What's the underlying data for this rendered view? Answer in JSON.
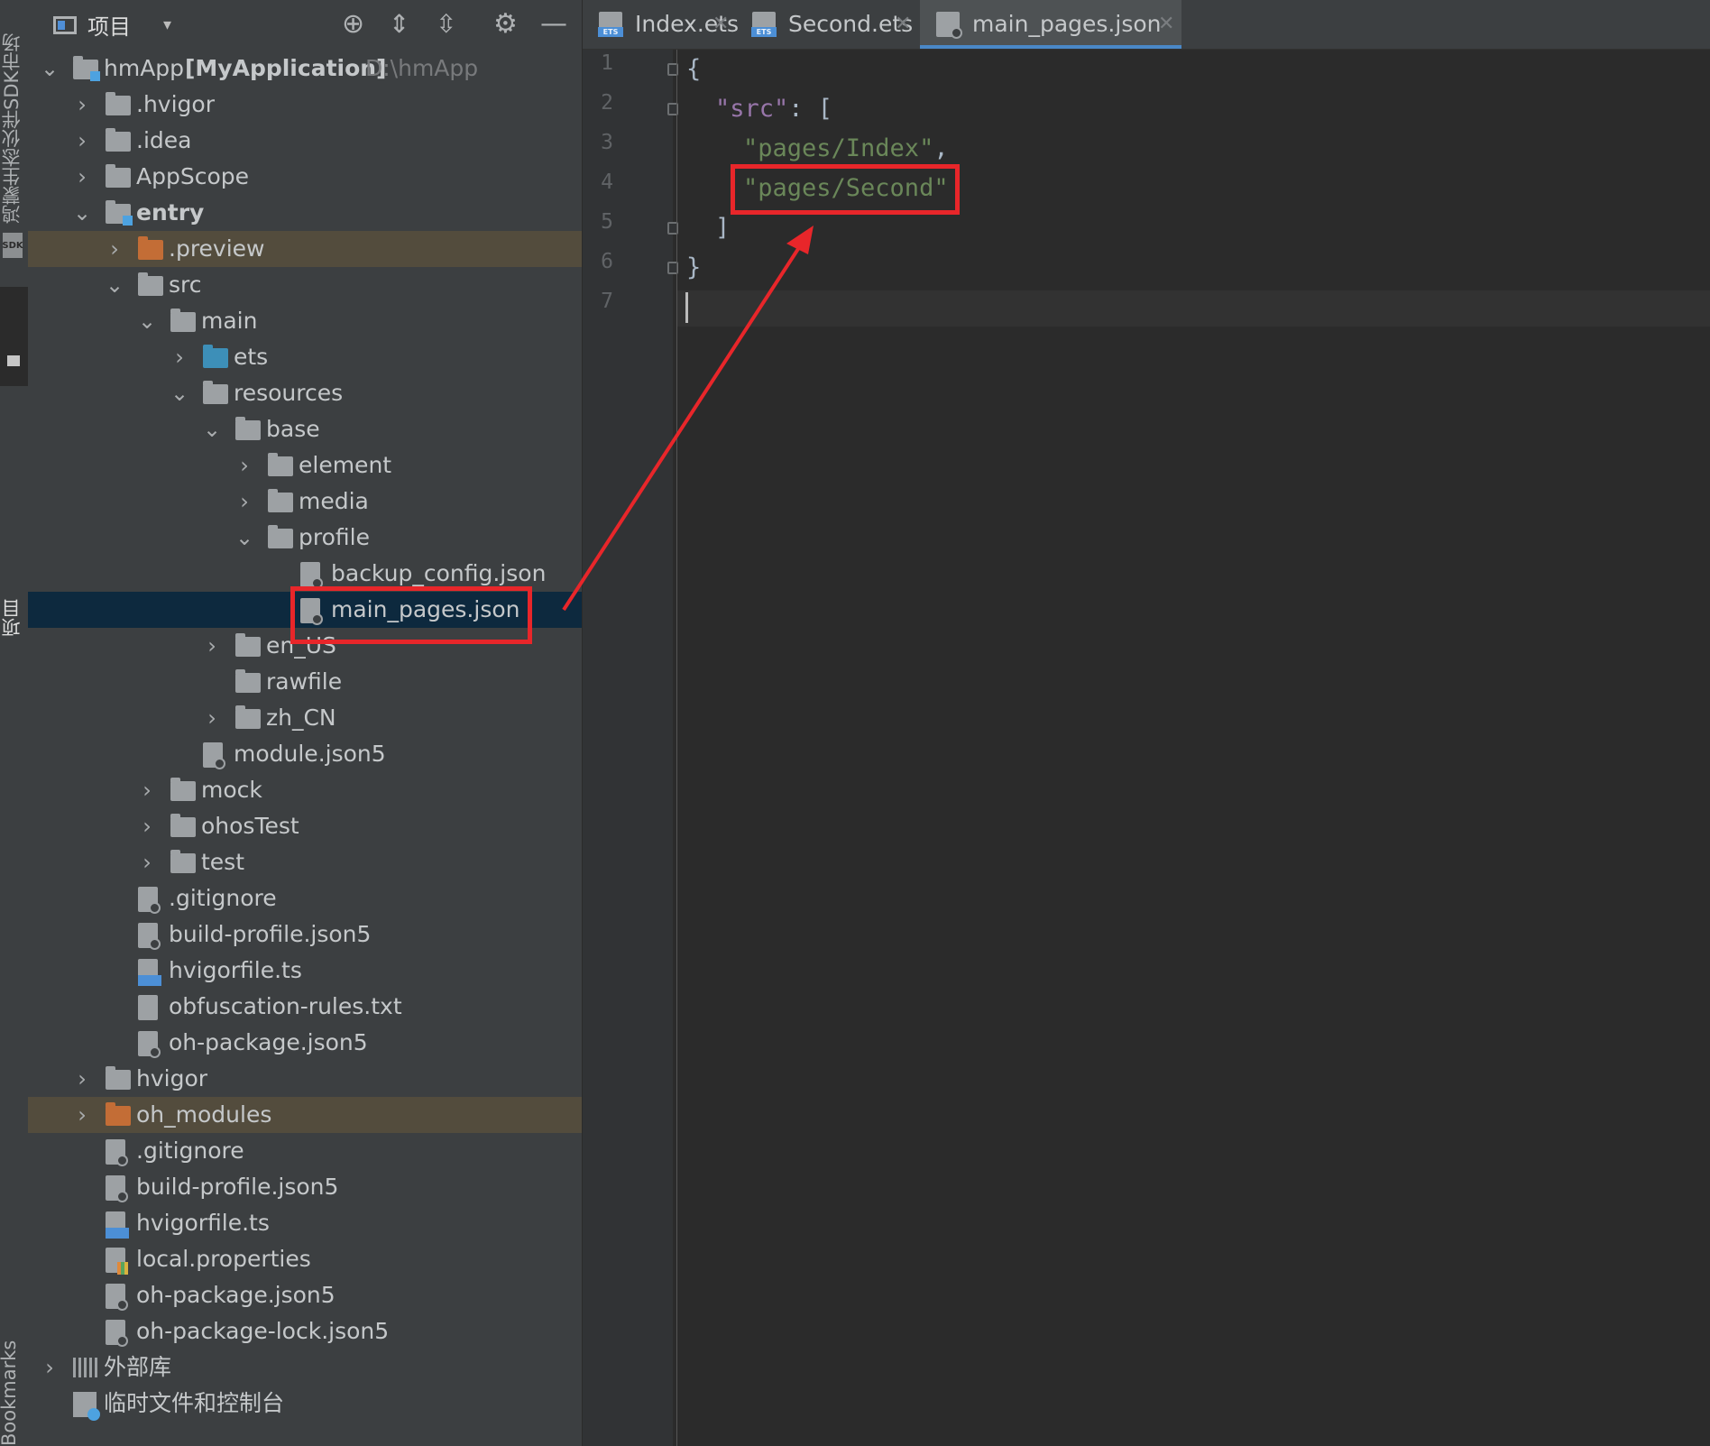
{
  "left_strip": {
    "market_label": "鸿蒙生态伙伴SDK市场",
    "sdk_badge": "SDK",
    "project_tab_label": "项目",
    "bookmarks_label": "Bookmarks"
  },
  "project_panel": {
    "title": "项目",
    "dropdown_glyph": "▾",
    "header_icons": [
      "target-icon",
      "expand-all-icon",
      "collapse-all-icon",
      "gear-icon",
      "minimize-icon"
    ],
    "tree": [
      {
        "label": "hmApp",
        "extra": "[MyApplication]",
        "path": "D:\\hmApp",
        "arrow": "⌄",
        "icon": "module-folder"
      },
      {
        "label": ".hvigor",
        "arrow": "›",
        "icon": "folder"
      },
      {
        "label": ".idea",
        "arrow": "›",
        "icon": "folder"
      },
      {
        "label": "AppScope",
        "arrow": "›",
        "icon": "folder"
      },
      {
        "label": "entry",
        "arrow": "⌄",
        "icon": "module-folder"
      },
      {
        "label": ".preview",
        "arrow": "›",
        "icon": "folder-orange"
      },
      {
        "label": "src",
        "arrow": "⌄",
        "icon": "folder"
      },
      {
        "label": "main",
        "arrow": "⌄",
        "icon": "folder"
      },
      {
        "label": "ets",
        "arrow": "›",
        "icon": "folder-blue"
      },
      {
        "label": "resources",
        "arrow": "⌄",
        "icon": "folder"
      },
      {
        "label": "base",
        "arrow": "⌄",
        "icon": "folder"
      },
      {
        "label": "element",
        "arrow": "›",
        "icon": "folder"
      },
      {
        "label": "media",
        "arrow": "›",
        "icon": "folder"
      },
      {
        "label": "profile",
        "arrow": "⌄",
        "icon": "folder"
      },
      {
        "label": "backup_config.json",
        "icon": "json-file"
      },
      {
        "label": "main_pages.json",
        "icon": "json-file",
        "selected": true
      },
      {
        "label": "en_US",
        "arrow": "›",
        "icon": "folder"
      },
      {
        "label": "rawfile",
        "icon": "folder"
      },
      {
        "label": "zh_CN",
        "arrow": "›",
        "icon": "folder"
      },
      {
        "label": "module.json5",
        "icon": "json-file"
      },
      {
        "label": "mock",
        "arrow": "›",
        "icon": "folder"
      },
      {
        "label": "ohosTest",
        "arrow": "›",
        "icon": "folder"
      },
      {
        "label": "test",
        "arrow": "›",
        "icon": "folder"
      },
      {
        "label": ".gitignore",
        "icon": "gitignore-file"
      },
      {
        "label": "build-profile.json5",
        "icon": "json-file"
      },
      {
        "label": "hvigorfile.ts",
        "icon": "ts-file"
      },
      {
        "label": "obfuscation-rules.txt",
        "icon": "text-file"
      },
      {
        "label": "oh-package.json5",
        "icon": "json-file"
      },
      {
        "label": "hvigor",
        "arrow": "›",
        "icon": "folder"
      },
      {
        "label": "oh_modules",
        "arrow": "›",
        "icon": "folder-orange"
      },
      {
        "label": ".gitignore",
        "icon": "gitignore-file"
      },
      {
        "label": "build-profile.json5",
        "icon": "json-file"
      },
      {
        "label": "hvigorfile.ts",
        "icon": "ts-file"
      },
      {
        "label": "local.properties",
        "icon": "properties-file"
      },
      {
        "label": "oh-package.json5",
        "icon": "json-file"
      },
      {
        "label": "oh-package-lock.json5",
        "icon": "json-file"
      },
      {
        "label": "外部库",
        "arrow": "›",
        "icon": "library"
      },
      {
        "label": "临时文件和控制台",
        "icon": "scratches"
      }
    ]
  },
  "editor": {
    "tabs": [
      {
        "label": "Index.ets",
        "close": "✕",
        "icon": "ets-file-icon",
        "active": false
      },
      {
        "label": "Second.ets",
        "close": "✕",
        "icon": "ets-file-icon",
        "active": false
      },
      {
        "label": "main_pages.json",
        "close": "✕",
        "icon": "json-file-icon",
        "active": true
      }
    ],
    "line_numbers": [
      "1",
      "2",
      "3",
      "4",
      "5",
      "6",
      "7"
    ],
    "code": {
      "l1_open": "{",
      "l2_key": "\"src\"",
      "l2_rest": ": [",
      "l3_str": "\"pages/Index\"",
      "l3_comma": ",",
      "l4_str": "\"pages/Second\"",
      "l5_close": "]",
      "l6_close": "}"
    },
    "current_line": 7
  },
  "colors": {
    "annotation_red": "#e8262a",
    "selection_bg": "#0d293e",
    "accent_tab": "#4a88c7"
  }
}
